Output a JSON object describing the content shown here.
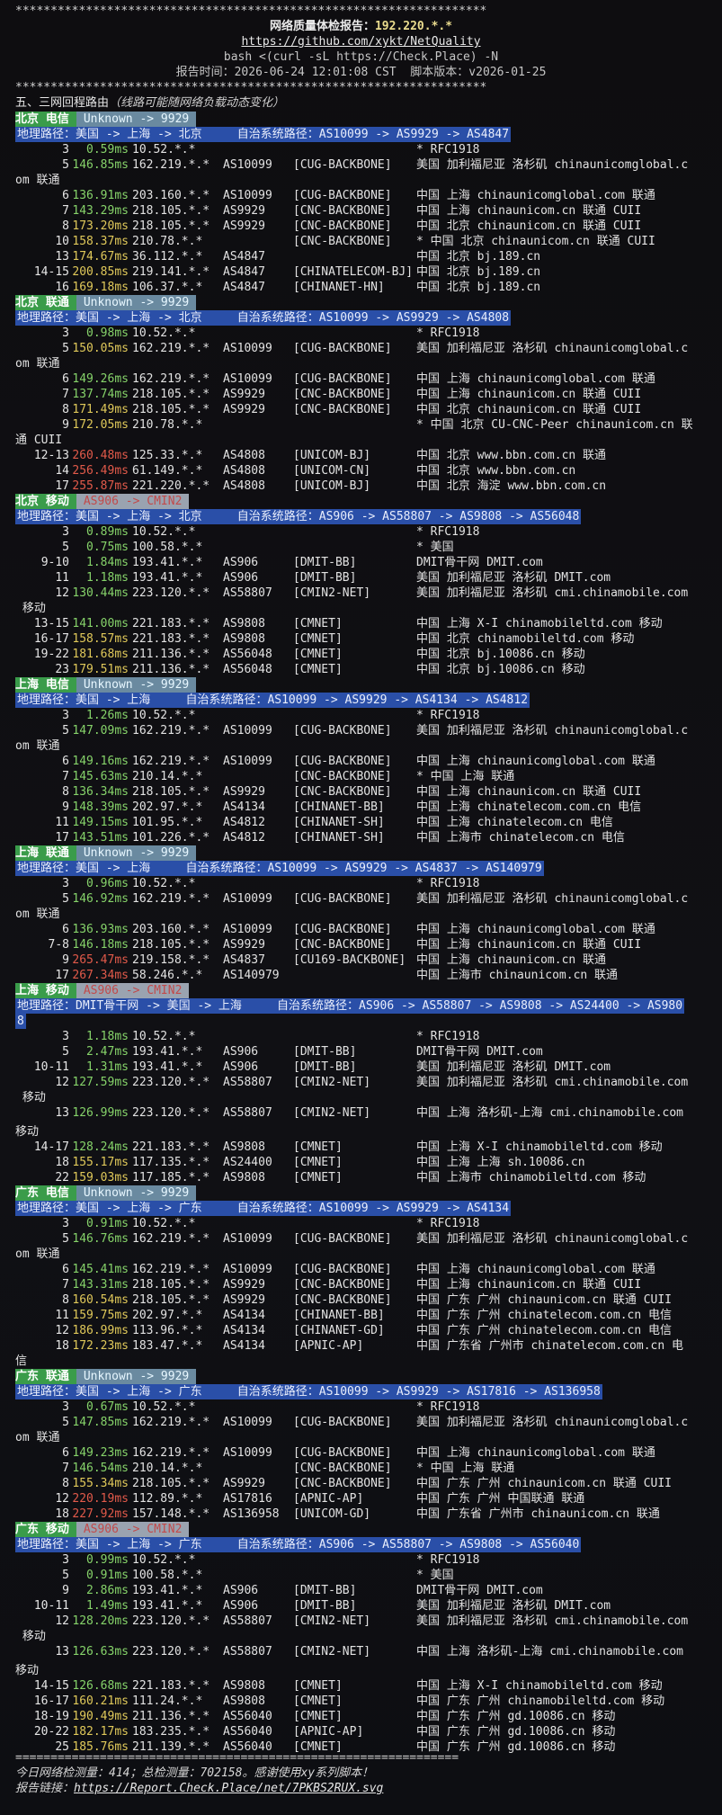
{
  "header": {
    "stars": "*******************************************************************",
    "title_label": "网络质量体检报告：",
    "title_ip": "192.220.*.*",
    "repo_link": "https://github.com/xykt/NetQuality",
    "command": "bash <(curl -sL https://Check.Place) -N",
    "report_time_label": "报告时间：",
    "report_time": "2026-06-24 12:01:08 CST",
    "script_version_label": "脚本版本：",
    "script_version": "v2026-01-25"
  },
  "section_title": "五、三网回程路由",
  "section_note": "（线路可能随网络负载动态变化）",
  "footer": {
    "separator": "===============================================================",
    "stats": "今日网络检测量：414；总检测量：702158。感谢使用xy系列脚本！",
    "link_label": "报告链接：",
    "link": "https://Report.Check.Place/net/7PKBS2RUX.svg"
  },
  "routes": [
    {
      "carrier": "北京 电信",
      "tag": "Unknown -> 9929",
      "tag_style": "unk",
      "path": "地理路径：美国 -> 上海 -> 北京     自治系统路径：AS10099 -> AS9929 -> AS4847",
      "hops": [
        {
          "n": "3",
          "lat": "0.59ms",
          "c": "g",
          "ip": "10.52.*.*",
          "asn": "",
          "tag": "",
          "geo": "* RFC1918"
        },
        {
          "n": "5",
          "lat": "146.85ms",
          "c": "g",
          "ip": "162.219.*.*",
          "asn": "AS10099",
          "tag": "[CUG-BACKBONE]",
          "geo": "美国 加利福尼亚 洛杉矶 chinaunicomglobal.c",
          "wrap": "om 联通"
        },
        {
          "n": "6",
          "lat": "136.91ms",
          "c": "g",
          "ip": "203.160.*.*",
          "asn": "AS10099",
          "tag": "[CUG-BACKBONE]",
          "geo": "中国 上海 chinaunicomglobal.com 联通"
        },
        {
          "n": "7",
          "lat": "143.29ms",
          "c": "g",
          "ip": "218.105.*.*",
          "asn": "AS9929",
          "tag": "[CNC-BACKBONE]",
          "geo": "中国 上海 chinaunicom.cn 联通 CUII"
        },
        {
          "n": "8",
          "lat": "173.20ms",
          "c": "y",
          "ip": "218.105.*.*",
          "asn": "AS9929",
          "tag": "[CNC-BACKBONE]",
          "geo": "中国 北京 chinaunicom.cn 联通 CUII"
        },
        {
          "n": "10",
          "lat": "158.37ms",
          "c": "y",
          "ip": "210.78.*.*",
          "asn": "",
          "tag": "[CNC-BACKBONE]",
          "geo": "* 中国 北京 chinaunicom.cn 联通 CUII"
        },
        {
          "n": "13",
          "lat": "174.67ms",
          "c": "y",
          "ip": "36.112.*.*",
          "asn": "AS4847",
          "tag": "",
          "geo": "中国 北京 bj.189.cn"
        },
        {
          "n": "14-15",
          "lat": "200.85ms",
          "c": "y",
          "ip": "219.141.*.*",
          "asn": "AS4847",
          "tag": "[CHINATELECOM-BJ]",
          "geo": "中国 北京 bj.189.cn"
        },
        {
          "n": "16",
          "lat": "169.18ms",
          "c": "y",
          "ip": "106.37.*.*",
          "asn": "AS4847",
          "tag": "[CHINANET-HN]",
          "geo": "中国 北京 bj.189.cn"
        }
      ]
    },
    {
      "carrier": "北京 联通",
      "tag": "Unknown -> 9929",
      "tag_style": "unk",
      "path": "地理路径：美国 -> 上海 -> 北京     自治系统路径：AS10099 -> AS9929 -> AS4808",
      "hops": [
        {
          "n": "3",
          "lat": "0.98ms",
          "c": "g",
          "ip": "10.52.*.*",
          "asn": "",
          "tag": "",
          "geo": "* RFC1918"
        },
        {
          "n": "5",
          "lat": "150.05ms",
          "c": "y",
          "ip": "162.219.*.*",
          "asn": "AS10099",
          "tag": "[CUG-BACKBONE]",
          "geo": "美国 加利福尼亚 洛杉矶 chinaunicomglobal.c",
          "wrap": "om 联通"
        },
        {
          "n": "6",
          "lat": "149.26ms",
          "c": "g",
          "ip": "162.219.*.*",
          "asn": "AS10099",
          "tag": "[CUG-BACKBONE]",
          "geo": "中国 上海 chinaunicomglobal.com 联通"
        },
        {
          "n": "7",
          "lat": "137.74ms",
          "c": "g",
          "ip": "218.105.*.*",
          "asn": "AS9929",
          "tag": "[CNC-BACKBONE]",
          "geo": "中国 上海 chinaunicom.cn 联通 CUII"
        },
        {
          "n": "8",
          "lat": "171.49ms",
          "c": "y",
          "ip": "218.105.*.*",
          "asn": "AS9929",
          "tag": "[CNC-BACKBONE]",
          "geo": "中国 北京 chinaunicom.cn 联通 CUII"
        },
        {
          "n": "9",
          "lat": "172.05ms",
          "c": "y",
          "ip": "210.78.*.*",
          "asn": "",
          "tag": "",
          "geo": "* 中国 北京 CU-CNC-Peer chinaunicom.cn 联",
          "wrap": "通 CUII"
        },
        {
          "n": "12-13",
          "lat": "260.48ms",
          "c": "r",
          "ip": "125.33.*.*",
          "asn": "AS4808",
          "tag": "[UNICOM-BJ]",
          "geo": "中国 北京 www.bbn.com.cn 联通"
        },
        {
          "n": "14",
          "lat": "256.49ms",
          "c": "r",
          "ip": "61.149.*.*",
          "asn": "AS4808",
          "tag": "[UNICOM-CN]",
          "geo": "中国 北京 www.bbn.com.cn"
        },
        {
          "n": "17",
          "lat": "255.87ms",
          "c": "r",
          "ip": "221.220.*.*",
          "asn": "AS4808",
          "tag": "[UNICOM-BJ]",
          "geo": "中国 北京 海淀 www.bbn.com.cn"
        }
      ]
    },
    {
      "carrier": "北京 移动",
      "tag": "AS906 -> CMIN2",
      "tag_style": "cmin",
      "path": "地理路径：美国 -> 上海 -> 北京     自治系统路径：AS906 -> AS58807 -> AS9808 -> AS56048",
      "hops": [
        {
          "n": "3",
          "lat": "0.89ms",
          "c": "g",
          "ip": "10.52.*.*",
          "asn": "",
          "tag": "",
          "geo": "* RFC1918"
        },
        {
          "n": "5",
          "lat": "0.75ms",
          "c": "g",
          "ip": "100.58.*.*",
          "asn": "",
          "tag": "",
          "geo": "* 美国"
        },
        {
          "n": "9-10",
          "lat": "1.84ms",
          "c": "g",
          "ip": "193.41.*.*",
          "asn": "AS906",
          "tag": "[DMIT-BB]",
          "geo": "DMIT骨干网 DMIT.com"
        },
        {
          "n": "11",
          "lat": "1.18ms",
          "c": "g",
          "ip": "193.41.*.*",
          "asn": "AS906",
          "tag": "[DMIT-BB]",
          "geo": "美国 加利福尼亚 洛杉矶 DMIT.com"
        },
        {
          "n": "12",
          "lat": "130.44ms",
          "c": "g",
          "ip": "223.120.*.*",
          "asn": "AS58807",
          "tag": "[CMIN2-NET]",
          "geo": "美国 加利福尼亚 洛杉矶 cmi.chinamobile.com",
          "wrap": " 移动"
        },
        {
          "n": "13-15",
          "lat": "141.00ms",
          "c": "g",
          "ip": "221.183.*.*",
          "asn": "AS9808",
          "tag": "[CMNET]",
          "geo": "中国 上海 X-I chinamobileltd.com 移动"
        },
        {
          "n": "16-17",
          "lat": "158.57ms",
          "c": "y",
          "ip": "221.183.*.*",
          "asn": "AS9808",
          "tag": "[CMNET]",
          "geo": "中国 北京 chinamobileltd.com 移动"
        },
        {
          "n": "19-22",
          "lat": "181.68ms",
          "c": "y",
          "ip": "211.136.*.*",
          "asn": "AS56048",
          "tag": "[CMNET]",
          "geo": "中国 北京 bj.10086.cn 移动"
        },
        {
          "n": "23",
          "lat": "179.51ms",
          "c": "y",
          "ip": "211.136.*.*",
          "asn": "AS56048",
          "tag": "[CMNET]",
          "geo": "中国 北京 bj.10086.cn 移动"
        }
      ]
    },
    {
      "carrier": "上海 电信",
      "tag": "Unknown -> 9929",
      "tag_style": "unk",
      "path": "地理路径：美国 -> 上海     自治系统路径：AS10099 -> AS9929 -> AS4134 -> AS4812",
      "hops": [
        {
          "n": "3",
          "lat": "1.26ms",
          "c": "g",
          "ip": "10.52.*.*",
          "asn": "",
          "tag": "",
          "geo": "* RFC1918"
        },
        {
          "n": "5",
          "lat": "147.09ms",
          "c": "g",
          "ip": "162.219.*.*",
          "asn": "AS10099",
          "tag": "[CUG-BACKBONE]",
          "geo": "美国 加利福尼亚 洛杉矶 chinaunicomglobal.c",
          "wrap": "om 联通"
        },
        {
          "n": "6",
          "lat": "149.16ms",
          "c": "g",
          "ip": "162.219.*.*",
          "asn": "AS10099",
          "tag": "[CUG-BACKBONE]",
          "geo": "中国 上海 chinaunicomglobal.com 联通"
        },
        {
          "n": "7",
          "lat": "145.63ms",
          "c": "g",
          "ip": "210.14.*.*",
          "asn": "",
          "tag": "[CNC-BACKBONE]",
          "geo": "* 中国 上海 联通"
        },
        {
          "n": "8",
          "lat": "136.34ms",
          "c": "g",
          "ip": "218.105.*.*",
          "asn": "AS9929",
          "tag": "[CNC-BACKBONE]",
          "geo": "中国 上海 chinaunicom.cn 联通 CUII"
        },
        {
          "n": "9",
          "lat": "148.39ms",
          "c": "g",
          "ip": "202.97.*.*",
          "asn": "AS4134",
          "tag": "[CHINANET-BB]",
          "geo": "中国 上海 chinatelecom.com.cn 电信"
        },
        {
          "n": "11",
          "lat": "149.15ms",
          "c": "g",
          "ip": "101.95.*.*",
          "asn": "AS4812",
          "tag": "[CHINANET-SH]",
          "geo": "中国 上海 chinatelecom.cn 电信"
        },
        {
          "n": "17",
          "lat": "143.51ms",
          "c": "g",
          "ip": "101.226.*.*",
          "asn": "AS4812",
          "tag": "[CHINANET-SH]",
          "geo": "中国 上海市 chinatelecom.cn 电信"
        }
      ]
    },
    {
      "carrier": "上海 联通",
      "tag": "Unknown -> 9929",
      "tag_style": "unk",
      "path": "地理路径：美国 -> 上海     自治系统路径：AS10099 -> AS9929 -> AS4837 -> AS140979",
      "hops": [
        {
          "n": "3",
          "lat": "0.96ms",
          "c": "g",
          "ip": "10.52.*.*",
          "asn": "",
          "tag": "",
          "geo": "* RFC1918"
        },
        {
          "n": "5",
          "lat": "146.92ms",
          "c": "g",
          "ip": "162.219.*.*",
          "asn": "AS10099",
          "tag": "[CUG-BACKBONE]",
          "geo": "美国 加利福尼亚 洛杉矶 chinaunicomglobal.c",
          "wrap": "om 联通"
        },
        {
          "n": "6",
          "lat": "136.93ms",
          "c": "g",
          "ip": "203.160.*.*",
          "asn": "AS10099",
          "tag": "[CUG-BACKBONE]",
          "geo": "中国 上海 chinaunicomglobal.com 联通"
        },
        {
          "n": "7-8",
          "lat": "146.18ms",
          "c": "g",
          "ip": "218.105.*.*",
          "asn": "AS9929",
          "tag": "[CNC-BACKBONE]",
          "geo": "中国 上海 chinaunicom.cn 联通 CUII"
        },
        {
          "n": "9",
          "lat": "265.47ms",
          "c": "r",
          "ip": "219.158.*.*",
          "asn": "AS4837",
          "tag": "[CU169-BACKBONE]",
          "geo": "中国 上海 chinaunicom.cn 联通"
        },
        {
          "n": "17",
          "lat": "267.34ms",
          "c": "r",
          "ip": "58.246.*.*",
          "asn": "AS140979",
          "tag": "",
          "geo": "中国 上海市 chinaunicom.cn 联通"
        }
      ]
    },
    {
      "carrier": "上海 移动",
      "tag": "AS906 -> CMIN2",
      "tag_style": "cmin",
      "path": "地理路径：DMIT骨干网 -> 美国 -> 上海     自治系统路径：AS906 -> AS58807 -> AS9808 -> AS24400 -> AS980",
      "path_wrap": "8",
      "hops": [
        {
          "n": "3",
          "lat": "1.18ms",
          "c": "g",
          "ip": "10.52.*.*",
          "asn": "",
          "tag": "",
          "geo": "* RFC1918"
        },
        {
          "n": "5",
          "lat": "2.47ms",
          "c": "g",
          "ip": "193.41.*.*",
          "asn": "AS906",
          "tag": "[DMIT-BB]",
          "geo": "DMIT骨干网 DMIT.com"
        },
        {
          "n": "10-11",
          "lat": "1.31ms",
          "c": "g",
          "ip": "193.41.*.*",
          "asn": "AS906",
          "tag": "[DMIT-BB]",
          "geo": "美国 加利福尼亚 洛杉矶 DMIT.com"
        },
        {
          "n": "12",
          "lat": "127.59ms",
          "c": "g",
          "ip": "223.120.*.*",
          "asn": "AS58807",
          "tag": "[CMIN2-NET]",
          "geo": "美国 加利福尼亚 洛杉矶 cmi.chinamobile.com",
          "wrap": " 移动"
        },
        {
          "n": "13",
          "lat": "126.99ms",
          "c": "g",
          "ip": "223.120.*.*",
          "asn": "AS58807",
          "tag": "[CMIN2-NET]",
          "geo": "中国 上海 洛杉矶-上海 cmi.chinamobile.com",
          "wrap": "移动",
          "gap": true
        },
        {
          "n": "14-17",
          "lat": "128.24ms",
          "c": "g",
          "ip": "221.183.*.*",
          "asn": "AS9808",
          "tag": "[CMNET]",
          "geo": "中国 上海 X-I chinamobileltd.com 移动"
        },
        {
          "n": "18",
          "lat": "155.17ms",
          "c": "y",
          "ip": "117.135.*.*",
          "asn": "AS24400",
          "tag": "[CMNET]",
          "geo": "中国 上海 上海 sh.10086.cn"
        },
        {
          "n": "22",
          "lat": "159.03ms",
          "c": "y",
          "ip": "117.185.*.*",
          "asn": "AS9808",
          "tag": "[CMNET]",
          "geo": "中国 上海市 chinamobileltd.com 移动"
        }
      ]
    },
    {
      "carrier": "广东 电信",
      "tag": "Unknown -> 9929",
      "tag_style": "unk",
      "path": "地理路径：美国 -> 上海 -> 广东     自治系统路径：AS10099 -> AS9929 -> AS4134",
      "hops": [
        {
          "n": "3",
          "lat": "0.91ms",
          "c": "g",
          "ip": "10.52.*.*",
          "asn": "",
          "tag": "",
          "geo": "* RFC1918"
        },
        {
          "n": "5",
          "lat": "146.76ms",
          "c": "g",
          "ip": "162.219.*.*",
          "asn": "AS10099",
          "tag": "[CUG-BACKBONE]",
          "geo": "美国 加利福尼亚 洛杉矶 chinaunicomglobal.c",
          "wrap": "om 联通"
        },
        {
          "n": "6",
          "lat": "145.41ms",
          "c": "g",
          "ip": "162.219.*.*",
          "asn": "AS10099",
          "tag": "[CUG-BACKBONE]",
          "geo": "中国 上海 chinaunicomglobal.com 联通"
        },
        {
          "n": "7",
          "lat": "143.31ms",
          "c": "g",
          "ip": "218.105.*.*",
          "asn": "AS9929",
          "tag": "[CNC-BACKBONE]",
          "geo": "中国 上海 chinaunicom.cn 联通 CUII"
        },
        {
          "n": "8",
          "lat": "160.54ms",
          "c": "y",
          "ip": "218.105.*.*",
          "asn": "AS9929",
          "tag": "[CNC-BACKBONE]",
          "geo": "中国 广东 广州 chinaunicom.cn 联通 CUII"
        },
        {
          "n": "11",
          "lat": "159.75ms",
          "c": "y",
          "ip": "202.97.*.*",
          "asn": "AS4134",
          "tag": "[CHINANET-BB]",
          "geo": "中国 广东 广州 chinatelecom.com.cn 电信"
        },
        {
          "n": "12",
          "lat": "186.99ms",
          "c": "y",
          "ip": "113.96.*.*",
          "asn": "AS4134",
          "tag": "[CHINANET-GD]",
          "geo": "中国 广东 广州 chinatelecom.com.cn 电信"
        },
        {
          "n": "18",
          "lat": "172.23ms",
          "c": "y",
          "ip": "183.47.*.*",
          "asn": "AS4134",
          "tag": "[APNIC-AP]",
          "geo": "中国 广东省 广州市 chinatelecom.com.cn 电",
          "wrap": "信"
        }
      ]
    },
    {
      "carrier": "广东 联通",
      "tag": "Unknown -> 9929",
      "tag_style": "unk",
      "path": "地理路径：美国 -> 上海 -> 广东     自治系统路径：AS10099 -> AS9929 -> AS17816 -> AS136958",
      "hops": [
        {
          "n": "3",
          "lat": "0.67ms",
          "c": "g",
          "ip": "10.52.*.*",
          "asn": "",
          "tag": "",
          "geo": "* RFC1918"
        },
        {
          "n": "5",
          "lat": "147.85ms",
          "c": "g",
          "ip": "162.219.*.*",
          "asn": "AS10099",
          "tag": "[CUG-BACKBONE]",
          "geo": "美国 加利福尼亚 洛杉矶 chinaunicomglobal.c",
          "wrap": "om 联通"
        },
        {
          "n": "6",
          "lat": "149.23ms",
          "c": "g",
          "ip": "162.219.*.*",
          "asn": "AS10099",
          "tag": "[CUG-BACKBONE]",
          "geo": "中国 上海 chinaunicomglobal.com 联通"
        },
        {
          "n": "7",
          "lat": "146.54ms",
          "c": "g",
          "ip": "210.14.*.*",
          "asn": "",
          "tag": "[CNC-BACKBONE]",
          "geo": "* 中国 上海 联通"
        },
        {
          "n": "8",
          "lat": "155.34ms",
          "c": "y",
          "ip": "218.105.*.*",
          "asn": "AS9929",
          "tag": "[CNC-BACKBONE]",
          "geo": "中国 广东 广州 chinaunicom.cn 联通 CUII"
        },
        {
          "n": "12",
          "lat": "220.19ms",
          "c": "r",
          "ip": "112.89.*.*",
          "asn": "AS17816",
          "tag": "[APNIC-AP]",
          "geo": "中国 广东 广州 中国联通 联通"
        },
        {
          "n": "18",
          "lat": "227.92ms",
          "c": "r",
          "ip": "157.148.*.*",
          "asn": "AS136958",
          "tag": "[UNICOM-GD]",
          "geo": "中国 广东省 广州市 chinaunicom.cn 联通"
        }
      ]
    },
    {
      "carrier": "广东 移动",
      "tag": "AS906 -> CMIN2",
      "tag_style": "cmin",
      "path": "地理路径：美国 -> 上海 -> 广东     自治系统路径：AS906 -> AS58807 -> AS9808 -> AS56040",
      "hops": [
        {
          "n": "3",
          "lat": "0.99ms",
          "c": "g",
          "ip": "10.52.*.*",
          "asn": "",
          "tag": "",
          "geo": "* RFC1918"
        },
        {
          "n": "5",
          "lat": "0.91ms",
          "c": "g",
          "ip": "100.58.*.*",
          "asn": "",
          "tag": "",
          "geo": "* 美国"
        },
        {
          "n": "9",
          "lat": "2.86ms",
          "c": "g",
          "ip": "193.41.*.*",
          "asn": "AS906",
          "tag": "[DMIT-BB]",
          "geo": "DMIT骨干网 DMIT.com"
        },
        {
          "n": "10-11",
          "lat": "1.49ms",
          "c": "g",
          "ip": "193.41.*.*",
          "asn": "AS906",
          "tag": "[DMIT-BB]",
          "geo": "美国 加利福尼亚 洛杉矶 DMIT.com"
        },
        {
          "n": "12",
          "lat": "128.20ms",
          "c": "g",
          "ip": "223.120.*.*",
          "asn": "AS58807",
          "tag": "[CMIN2-NET]",
          "geo": "美国 加利福尼亚 洛杉矶 cmi.chinamobile.com",
          "wrap": " 移动"
        },
        {
          "n": "13",
          "lat": "126.63ms",
          "c": "g",
          "ip": "223.120.*.*",
          "asn": "AS58807",
          "tag": "[CMIN2-NET]",
          "geo": "中国 上海 洛杉矶-上海 cmi.chinamobile.com",
          "wrap": "移动",
          "gap": true
        },
        {
          "n": "14-15",
          "lat": "126.68ms",
          "c": "g",
          "ip": "221.183.*.*",
          "asn": "AS9808",
          "tag": "[CMNET]",
          "geo": "中国 上海 X-I chinamobileltd.com 移动"
        },
        {
          "n": "16-17",
          "lat": "160.21ms",
          "c": "y",
          "ip": "111.24.*.*",
          "asn": "AS9808",
          "tag": "[CMNET]",
          "geo": "中国 广东 广州 chinamobileltd.com 移动"
        },
        {
          "n": "18-19",
          "lat": "190.49ms",
          "c": "y",
          "ip": "211.136.*.*",
          "asn": "AS56040",
          "tag": "[CMNET]",
          "geo": "中国 广东 广州 gd.10086.cn 移动"
        },
        {
          "n": "20-22",
          "lat": "182.17ms",
          "c": "y",
          "ip": "183.235.*.*",
          "asn": "AS56040",
          "tag": "[APNIC-AP]",
          "geo": "中国 广东 广州 gd.10086.cn 移动"
        },
        {
          "n": "25",
          "lat": "185.76ms",
          "c": "y",
          "ip": "211.139.*.*",
          "asn": "AS56040",
          "tag": "[CMNET]",
          "geo": "中国 广东 广州 gd.10086.cn 移动"
        }
      ]
    }
  ]
}
